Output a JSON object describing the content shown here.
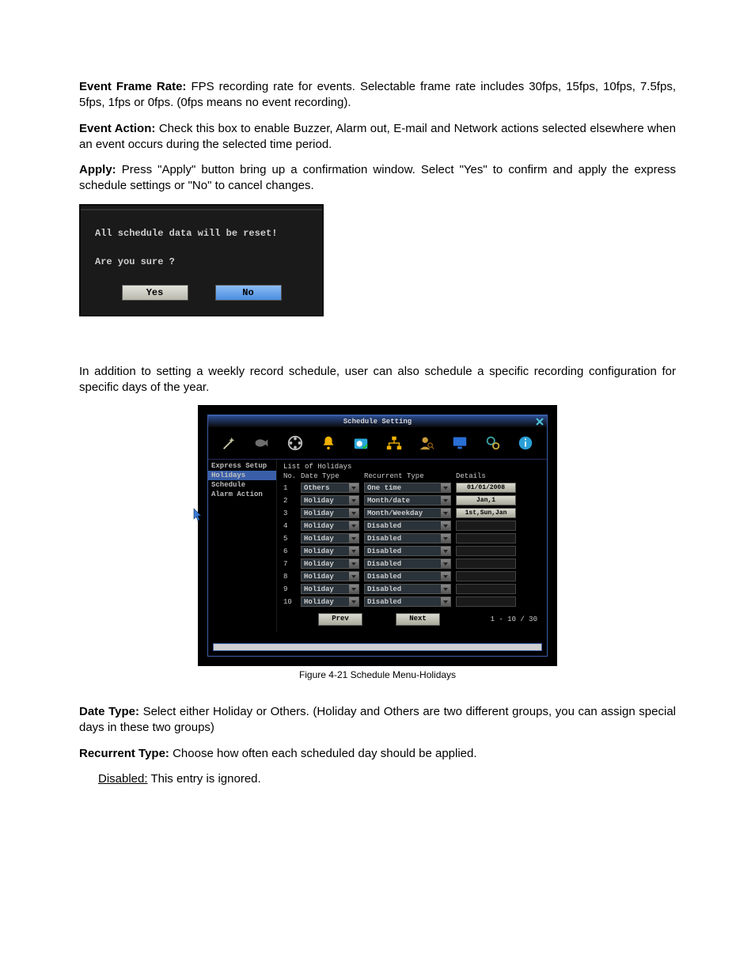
{
  "para1": {
    "label": "Event Frame Rate:",
    "text": " FPS recording rate for events. Selectable frame rate includes 30fps, 15fps, 10fps, 7.5fps, 5fps, 1fps or 0fps. (0fps means no event recording)."
  },
  "para2": {
    "label": "Event Action:",
    "text": " Check this box to enable Buzzer, Alarm out, E-mail and Network actions selected elsewhere when an event occurs during the selected time period."
  },
  "para3": {
    "label": "Apply:",
    "text": " Press \"Apply\" button bring up a confirmation window. Select \"Yes\" to confirm and apply the express schedule settings or \"No\" to cancel changes."
  },
  "confirm": {
    "line1": "All schedule data will be reset!",
    "line2": "Are you sure ?",
    "yes": "Yes",
    "no": "No"
  },
  "para4": "In addition to setting a weekly record schedule, user can also schedule a specific recording configuration for specific days of the year.",
  "sched": {
    "title": "Schedule Setting",
    "sidebar": [
      "Express Setup",
      "Holidays",
      "Schedule",
      "Alarm Action"
    ],
    "sidebar_selected": 1,
    "list_title": "List of Holidays",
    "headers": {
      "no": "No.",
      "dt": "Date Type",
      "rt": "Recurrent Type",
      "det": "Details"
    },
    "rows": [
      {
        "no": "1",
        "dt": "Others",
        "rt": "One time",
        "det": "01/01/2008"
      },
      {
        "no": "2",
        "dt": "Holiday",
        "rt": "Month/date",
        "det": "Jan,1"
      },
      {
        "no": "3",
        "dt": "Holiday",
        "rt": "Month/Weekday",
        "det": "1st,Sun,Jan"
      },
      {
        "no": "4",
        "dt": "Holiday",
        "rt": "Disabled",
        "det": ""
      },
      {
        "no": "5",
        "dt": "Holiday",
        "rt": "Disabled",
        "det": ""
      },
      {
        "no": "6",
        "dt": "Holiday",
        "rt": "Disabled",
        "det": ""
      },
      {
        "no": "7",
        "dt": "Holiday",
        "rt": "Disabled",
        "det": ""
      },
      {
        "no": "8",
        "dt": "Holiday",
        "rt": "Disabled",
        "det": ""
      },
      {
        "no": "9",
        "dt": "Holiday",
        "rt": "Disabled",
        "det": ""
      },
      {
        "no": "10",
        "dt": "Holiday",
        "rt": "Disabled",
        "det": ""
      }
    ],
    "prev": "Prev",
    "next": "Next",
    "counter": "1 - 10 / 30"
  },
  "caption": "Figure 4-21 Schedule Menu-Holidays",
  "para5": {
    "label": "Date Type:",
    "text": " Select either Holiday or Others. (Holiday and Others are two different groups, you can assign special days in these two groups)"
  },
  "para6": {
    "label": "Recurrent Type:",
    "text": " Choose how often each scheduled day should be applied."
  },
  "para7": {
    "label": "Disabled:",
    "text": " This entry is ignored."
  }
}
